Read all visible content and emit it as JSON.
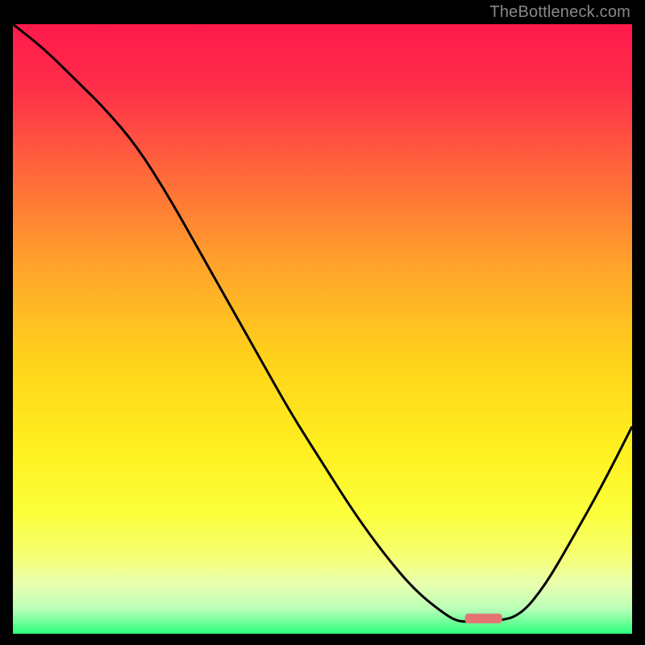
{
  "attribution": "TheBottleneck.com",
  "chart_data": {
    "type": "line",
    "title": "",
    "xlabel": "",
    "ylabel": "",
    "xlim": [
      0,
      100
    ],
    "ylim": [
      0,
      100
    ],
    "series": [
      {
        "name": "curve",
        "x": [
          0,
          5,
          10,
          15,
          20,
          25,
          30,
          35,
          40,
          45,
          50,
          55,
          60,
          65,
          70,
          72,
          74,
          78,
          82,
          86,
          90,
          95,
          100
        ],
        "y": [
          100,
          96,
          91,
          86,
          80,
          72,
          63,
          54,
          45,
          36,
          28,
          20,
          13,
          7,
          3,
          2,
          2,
          2,
          3,
          8,
          15,
          24,
          34
        ]
      }
    ],
    "marker": {
      "x_center": 76,
      "width": 6,
      "y": 2.5,
      "color": "#e57373"
    },
    "gradient_stops": [
      {
        "offset": 0.0,
        "color": "#ff1a4b"
      },
      {
        "offset": 0.1,
        "color": "#ff2d4a"
      },
      {
        "offset": 0.25,
        "color": "#ff6a3a"
      },
      {
        "offset": 0.4,
        "color": "#ffa52a"
      },
      {
        "offset": 0.55,
        "color": "#ffd21a"
      },
      {
        "offset": 0.7,
        "color": "#fff020"
      },
      {
        "offset": 0.8,
        "color": "#fbff3a"
      },
      {
        "offset": 0.87,
        "color": "#f6ff70"
      },
      {
        "offset": 0.92,
        "color": "#e8ffb0"
      },
      {
        "offset": 0.96,
        "color": "#b8ffb8"
      },
      {
        "offset": 1.0,
        "color": "#2aff7a"
      }
    ]
  }
}
